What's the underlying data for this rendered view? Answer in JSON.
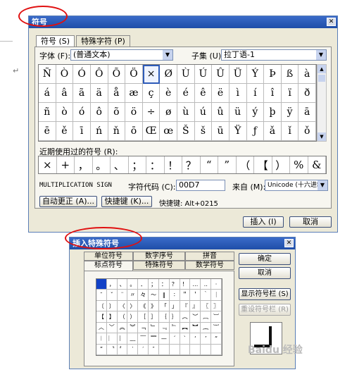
{
  "dialog1": {
    "title": "符号",
    "tabs": [
      "符号 (S)",
      "特殊字符 (P)"
    ],
    "font_label": "字体 (F):",
    "font_value": "(普通文本)",
    "subset_label": "子集 (U):",
    "subset_value": "拉丁语-1",
    "symbols": [
      "Ñ",
      "Ò",
      "Ó",
      "Ô",
      "Õ",
      "Ö",
      "×",
      "Ø",
      "Ù",
      "Ú",
      "Û",
      "Ü",
      "Ý",
      "Þ",
      "ß",
      "à",
      "á",
      "â",
      "ã",
      "ä",
      "å",
      "æ",
      "ç",
      "è",
      "é",
      "ê",
      "ë",
      "ì",
      "í",
      "î",
      "ï",
      "ð",
      "ñ",
      "ò",
      "ó",
      "ô",
      "õ",
      "ö",
      "÷",
      "ø",
      "ù",
      "ú",
      "û",
      "ü",
      "ý",
      "þ",
      "ÿ",
      "ā",
      "ē",
      "ě",
      "ī",
      "ń",
      "ň",
      "ō",
      "Œ",
      "œ",
      "Š",
      "š",
      "ū",
      "Ÿ",
      "ƒ",
      "ǎ",
      "ǐ",
      "ǒ"
    ],
    "recent_label": "近期使用过的符号 (R):",
    "recent": [
      "×",
      "+",
      "，",
      "。",
      "、",
      "；",
      "：",
      "！",
      "？",
      "“",
      "”",
      "（",
      "【",
      "）",
      "%",
      "&"
    ],
    "char_name": "MULTIPLICATION SIGN",
    "code_label": "字符代码 (C):",
    "code_value": "00D7",
    "from_label": "来自 (M):",
    "from_value": "Unicode (十六进制)",
    "autocorrect_button": "自动更正 (A)...",
    "shortcut_button": "快捷键 (K)...",
    "shortcut_text": "快捷键: Alt+0215",
    "insert_button": "插入 (I)",
    "cancel_button": "取消"
  },
  "dialog2": {
    "title": "插入特殊符号",
    "tabs_row1": [
      "单位符号",
      "数字序号",
      "拼音"
    ],
    "tabs_row2": [
      "标点符号",
      "特殊符号",
      "数学符号"
    ],
    "symbols": [
      "",
      "，",
      "、",
      "。",
      "．",
      "；",
      "：",
      "？",
      "！",
      "…",
      "‥",
      "·",
      "ˉ",
      "ˇ",
      "¨",
      "〃",
      "々",
      "～",
      "‖",
      "∶",
      "＂",
      "＇",
      "｀",
      "｜",
      "〔",
      "〕",
      "〈",
      "〉",
      "《",
      "》",
      "「",
      "」",
      "『",
      "』",
      "〖",
      "〗",
      "【",
      "】",
      "（",
      "）",
      "［",
      "］",
      "｛",
      "｝",
      "︵",
      "︶",
      "︹",
      "︺",
      "︿",
      "﹀",
      "︽",
      "︾",
      "﹁",
      "﹂",
      "﹃",
      "﹄",
      "︻",
      "︼",
      "︷",
      "︸",
      "︱",
      "︳",
      "︴",
      "﹏",
      "﹋",
      "﹌",
      "—",
      "ˊ",
      "ˋ",
      "‘",
      "’",
      "“",
      "”",
      "〝",
      "〞",
      "‵",
      "′",
      "″",
      "",
      "",
      "",
      "",
      "",
      ""
    ],
    "ok_button": "确定",
    "cancel_button": "取消",
    "show_bar_button": "显示符号栏 (S)",
    "reset_bar_button": "重设符号栏 (R)"
  },
  "colors": {
    "title_bar": "#1f4ea8",
    "annotation": "#e01010",
    "selected": "#1242c7"
  }
}
